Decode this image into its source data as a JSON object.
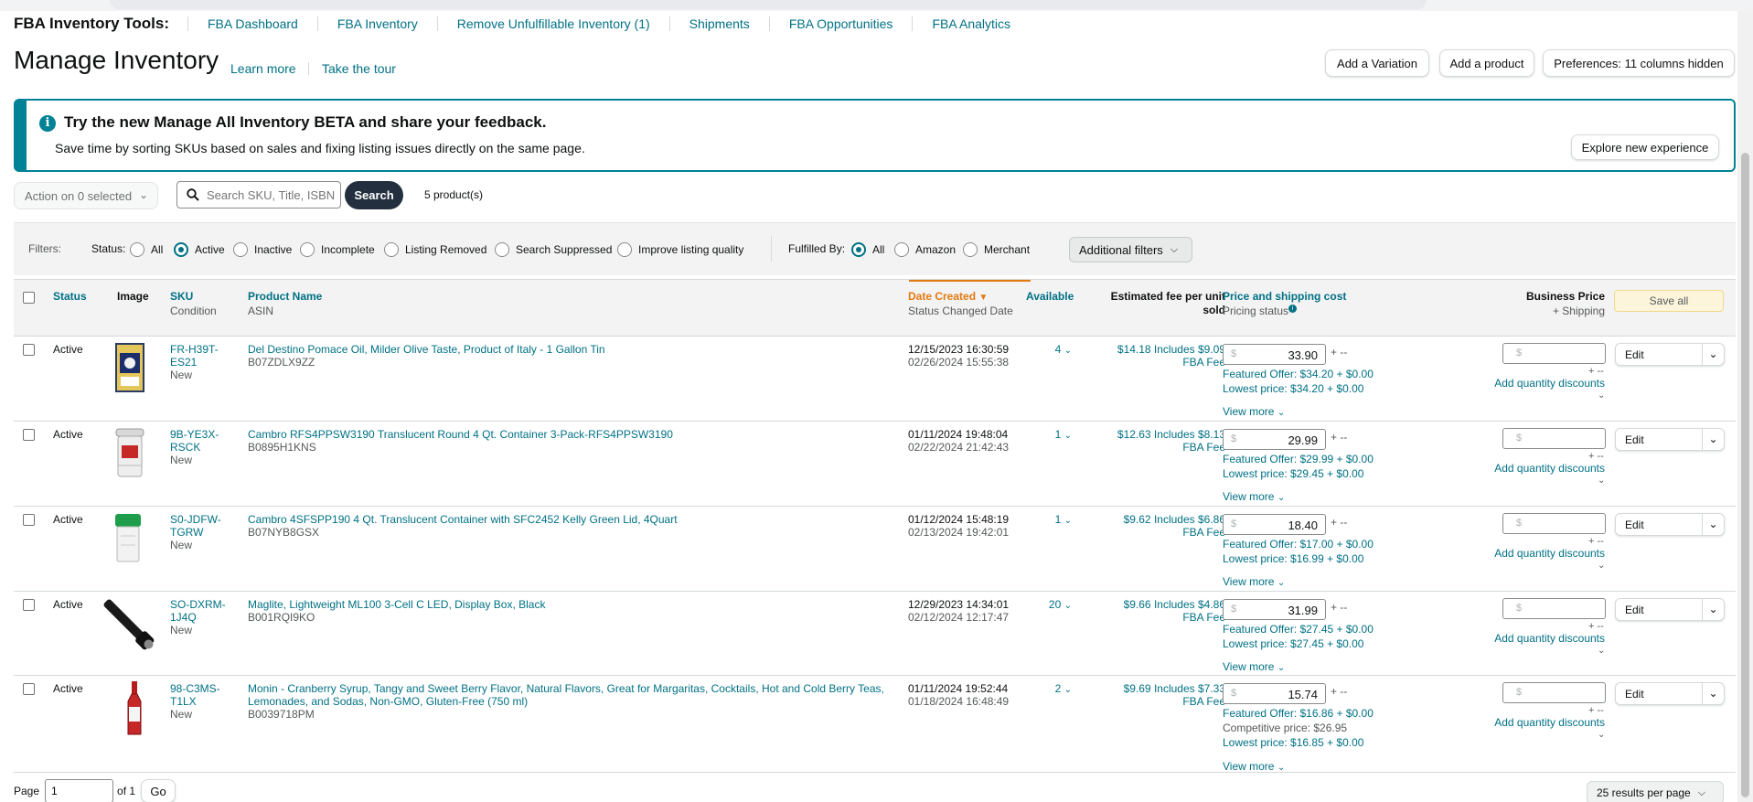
{
  "tools_nav": {
    "title": "FBA Inventory Tools:",
    "items": [
      "FBA Dashboard",
      "FBA Inventory",
      "Remove Unfulfillable Inventory (1)",
      "Shipments",
      "FBA Opportunities",
      "FBA Analytics"
    ]
  },
  "header": {
    "title": "Manage Inventory",
    "learn_more": "Learn more",
    "take_tour": "Take the tour",
    "buttons": {
      "add_variation": "Add a Variation",
      "add_product": "Add a product",
      "preferences": "Preferences: 11 columns hidden"
    }
  },
  "banner": {
    "icon": "info-icon",
    "title": "Try the new Manage All Inventory BETA and share your feedback.",
    "subtitle": "Save time by sorting SKUs based on sales and fixing listing issues directly on the same page.",
    "button": "Explore new experience"
  },
  "toolbar": {
    "action": "Action on 0 selected",
    "search_placeholder": "Search SKU, Title, ISBN,",
    "search_button": "Search",
    "count": "5 product(s)"
  },
  "filters": {
    "label": "Filters:",
    "status_label": "Status:",
    "status_options": [
      "All",
      "Active",
      "Inactive",
      "Incomplete",
      "Listing Removed",
      "Search Suppressed",
      "Improve listing quality"
    ],
    "status_selected": "Active",
    "fulfilled_label": "Fulfilled By:",
    "fulfilled_options": [
      "All",
      "Amazon",
      "Merchant"
    ],
    "fulfilled_selected": "All",
    "additional": "Additional filters"
  },
  "table": {
    "headers": {
      "status": "Status",
      "image": "Image",
      "sku": "SKU",
      "sku_sub": "Condition",
      "product": "Product Name",
      "product_sub": "ASIN",
      "date": "Date Created",
      "date_sub": "Status Changed Date",
      "available": "Available",
      "fee": "Estimated fee per unit sold",
      "price": "Price and shipping cost",
      "price_sub": "Pricing status",
      "business": "Business Price",
      "business_sub": "+ Shipping",
      "save_all": "Save all"
    },
    "rows": [
      {
        "status": "Active",
        "image_icon": "olive-oil-tin-image",
        "sku": "FR-H39T-ES21",
        "condition": "New",
        "name": "Del Destino Pomace Oil, Milder Olive Taste, Product of Italy - 1 Gallon Tin",
        "asin": "B07ZDLX9ZZ",
        "created": "12/15/2023 16:30:59",
        "changed": "02/26/2024 15:55:38",
        "available": "4",
        "fee": "$14.18 Includes $9.09 FBA Fee",
        "price": "33.90",
        "ship": "+ --",
        "featured": "Featured Offer: $34.20 + $0.00",
        "competitive": "",
        "lowest": "Lowest price: $34.20 + $0.00",
        "view_more": "View more",
        "biz_ship": "+ --",
        "qty_disc": "Add quantity discounts",
        "edit": "Edit"
      },
      {
        "status": "Active",
        "image_icon": "container-pack-image",
        "sku": "9B-YE3X-RSCK",
        "condition": "New",
        "name": "Cambro RFS4PPSW3190 Translucent Round 4 Qt. Container 3-Pack-RFS4PPSW3190",
        "asin": "B0895H1KNS",
        "created": "01/11/2024 19:48:04",
        "changed": "02/22/2024 21:42:43",
        "available": "1",
        "fee": "$12.63 Includes $8.13 FBA Fee",
        "price": "29.99",
        "ship": "+ --",
        "featured": "Featured Offer: $29.99 + $0.00",
        "competitive": "",
        "lowest": "Lowest price: $29.45 + $0.00",
        "view_more": "View more",
        "biz_ship": "+ --",
        "qty_disc": "Add quantity discounts",
        "edit": "Edit"
      },
      {
        "status": "Active",
        "image_icon": "green-lid-container-image",
        "sku": "S0-JDFW-TGRW",
        "condition": "New",
        "name": "Cambro 4SFSPP190 4 Qt. Translucent Container with SFC2452 Kelly Green Lid, 4Quart",
        "asin": "B07NYB8GSX",
        "created": "01/12/2024 15:48:19",
        "changed": "02/13/2024 19:42:01",
        "available": "1",
        "fee": "$9.62 Includes $6.86 FBA Fee",
        "price": "18.40",
        "ship": "+ --",
        "featured": "Featured Offer: $17.00 + $0.00",
        "competitive": "",
        "lowest": "Lowest price: $16.99 + $0.00",
        "view_more": "View more",
        "biz_ship": "+ --",
        "qty_disc": "Add quantity discounts",
        "edit": "Edit"
      },
      {
        "status": "Active",
        "image_icon": "flashlight-image",
        "sku": "SO-DXRM-1J4Q",
        "condition": "New",
        "name": "Maglite, Lightweight ML100 3-Cell C LED, Display Box, Black",
        "asin": "B001RQI9KO",
        "created": "12/29/2023 14:34:01",
        "changed": "02/12/2024 12:17:47",
        "available": "20",
        "fee": "$9.66 Includes $4.86 FBA Fee",
        "price": "31.99",
        "ship": "+ --",
        "featured": "Featured Offer: $27.45 + $0.00",
        "competitive": "",
        "lowest": "Lowest price: $27.45 + $0.00",
        "view_more": "View more",
        "biz_ship": "+ --",
        "qty_disc": "Add quantity discounts",
        "edit": "Edit"
      },
      {
        "status": "Active",
        "image_icon": "syrup-bottle-image",
        "sku": "98-C3MS-T1LX",
        "condition": "New",
        "name": "Monin - Cranberry Syrup, Tangy and Sweet Berry Flavor, Natural Flavors, Great for Margaritas, Cocktails, Hot and Cold Berry Teas, Lemonades, and Sodas, Non-GMO, Gluten-Free (750 ml)",
        "asin": "B0039718PM",
        "created": "01/11/2024 19:52:44",
        "changed": "01/18/2024 16:48:49",
        "available": "2",
        "fee": "$9.69 Includes $7.33 FBA Fee",
        "price": "15.74",
        "ship": "+ --",
        "featured": "Featured Offer: $16.86 + $0.00",
        "competitive": "Competitive price: $26.95",
        "lowest": "Lowest price: $16.85 + $0.00",
        "view_more": "View more",
        "biz_ship": "+ --",
        "qty_disc": "Add quantity discounts",
        "edit": "Edit"
      }
    ],
    "currency_symbol": "$"
  },
  "pager": {
    "page_label": "Page",
    "page_value": "1",
    "of_label": "of 1",
    "go": "Go",
    "per_page": "25 results per page"
  },
  "colors": {
    "accent": "#007185",
    "banner_border": "#008296",
    "sort_active": "#e47911",
    "search_button": "#232f3e"
  }
}
